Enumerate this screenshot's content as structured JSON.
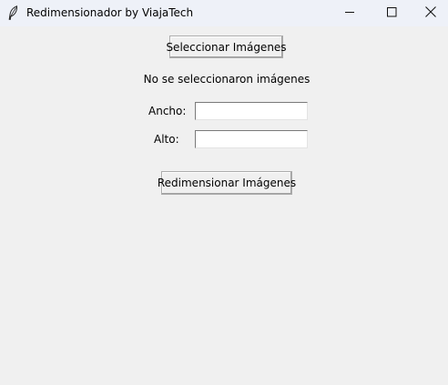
{
  "window": {
    "title": "Redimensionador by ViajaTech",
    "icon": "feather-icon",
    "controls": [
      "minimize-icon",
      "maximize-icon",
      "close-icon"
    ]
  },
  "main": {
    "select_button_label": "Seleccionar Imágenes",
    "status_text": "No se seleccionaron imágenes",
    "width_label": "Ancho:",
    "width_value": "",
    "height_label": "Alto:",
    "height_value": "",
    "resize_button_label": "Redimensionar Imágenes"
  },
  "colors": {
    "background": "#f0f0f0",
    "titlebar": "#eef1f8",
    "entry_background": "#ffffff"
  }
}
